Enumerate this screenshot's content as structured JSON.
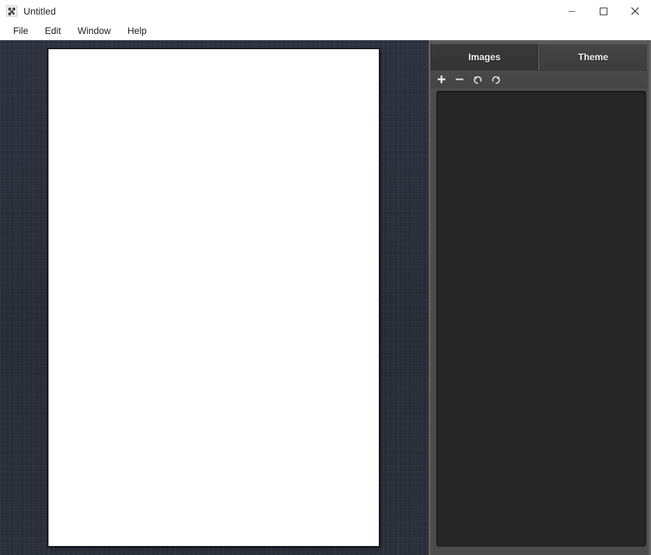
{
  "window": {
    "title": "Untitled",
    "icon": "app-icon",
    "controls": [
      {
        "name": "minimize",
        "glyph": "minimize-icon"
      },
      {
        "name": "maximize",
        "glyph": "maximize-icon"
      },
      {
        "name": "close",
        "glyph": "close-icon"
      }
    ]
  },
  "menu": {
    "items": [
      {
        "label": "File"
      },
      {
        "label": "Edit"
      },
      {
        "label": "Window"
      },
      {
        "label": "Help"
      }
    ]
  },
  "canvas": {
    "background": "#2b2f3a",
    "page": {
      "name": "document-page",
      "fill": "#ffffff",
      "border": "#15171d",
      "content": ""
    }
  },
  "dock": {
    "tabs": [
      {
        "label": "Images",
        "active": true
      },
      {
        "label": "Theme",
        "active": false
      }
    ],
    "toolbar": {
      "buttons": [
        {
          "label": "+",
          "icon": "plus-icon",
          "title": "Add image"
        },
        {
          "label": "−",
          "icon": "minus-icon",
          "title": "Remove image"
        },
        {
          "label": "↺",
          "icon": "rotate-left-icon",
          "title": "Rotate left"
        },
        {
          "label": "↻",
          "icon": "rotate-right-icon",
          "title": "Rotate right"
        }
      ]
    },
    "list": {
      "name": "image-list",
      "items": [],
      "empty_text": "",
      "background": "#262626"
    }
  },
  "colors": {
    "panel_bg": "#4c4c4c",
    "tab_active_bg": "#333333",
    "tab_inactive_bg": "#454545",
    "list_bg": "#262626",
    "canvas_bg": "#2b2f3a",
    "page_bg": "#ffffff",
    "titlebar_bg": "#ffffff",
    "text": "#1c1c1c"
  }
}
